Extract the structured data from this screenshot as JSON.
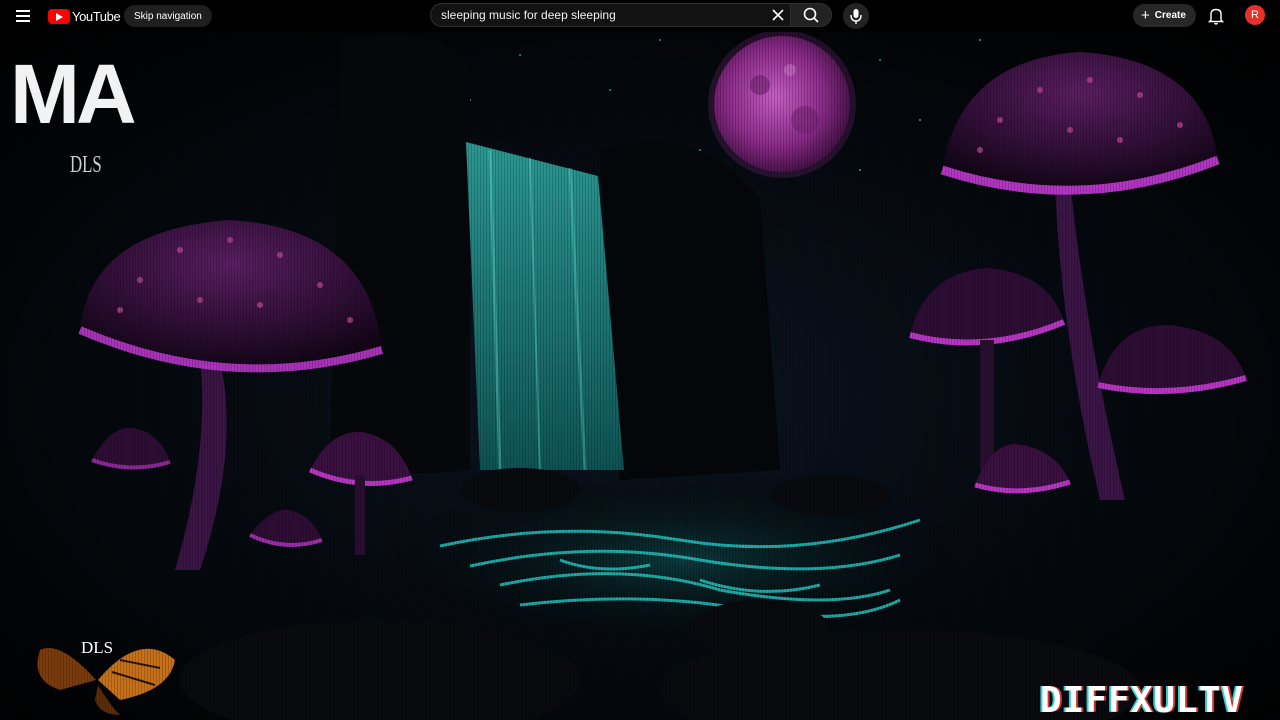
{
  "header": {
    "logo_text": "YouTube",
    "skip_nav_label": "Skip navigation",
    "search_value": "sleeping music for deep sleeping",
    "create_label": "Create",
    "avatar_initial": "R",
    "icons": [
      "menu-icon",
      "youtube-logo-icon",
      "clear-icon",
      "search-icon",
      "mic-icon",
      "plus-icon",
      "bell-icon"
    ]
  },
  "video_overlay": {
    "channel_logo_text": "MA",
    "channel_logo_sub": "DLS",
    "corner_brand": "DLS",
    "watermark": "DIFFXULTV"
  },
  "colors": {
    "accent": "#ff0000",
    "avatar": "#e4322b",
    "mushroom_glow": "#c43bd6",
    "water_glow": "#22c5c0"
  }
}
